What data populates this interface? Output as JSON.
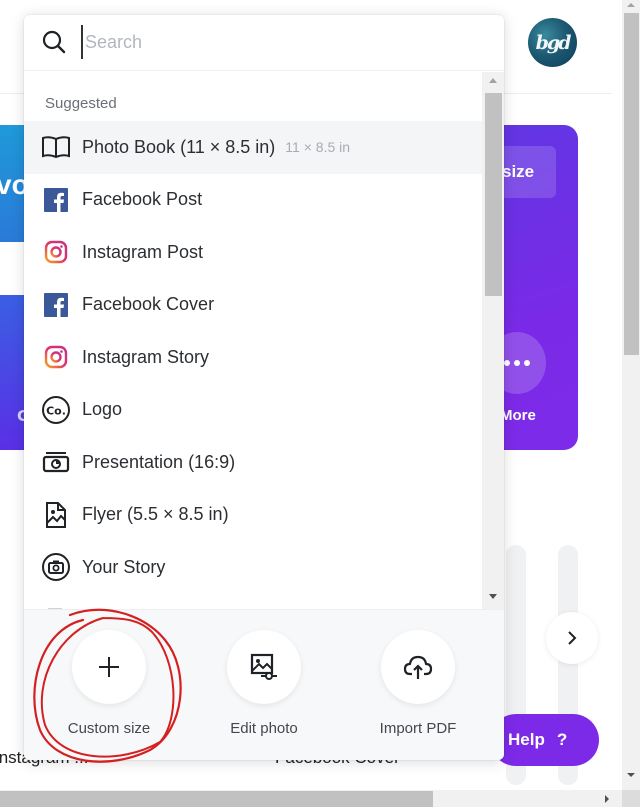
{
  "background": {
    "avatar_initials": "bgd",
    "hero_left_text": "vo",
    "hero_left_bottom_text": "G",
    "hero_right_button": "size",
    "hero_more_label": "More",
    "captions": [
      "Instagram ...",
      "Facebook Cover"
    ],
    "help_button": {
      "label": "Help",
      "icon": "?"
    }
  },
  "dropdown": {
    "search": {
      "placeholder": "Search",
      "value": ""
    },
    "section_label": "Suggested",
    "items": [
      {
        "label": "Photo Book (11 × 8.5 in)",
        "sub": "11 × 8.5 in",
        "icon": "book-icon",
        "active": true
      },
      {
        "label": "Facebook Post",
        "sub": "",
        "icon": "facebook-icon"
      },
      {
        "label": "Instagram Post",
        "sub": "",
        "icon": "instagram-icon"
      },
      {
        "label": "Facebook Cover",
        "sub": "",
        "icon": "facebook-icon"
      },
      {
        "label": "Instagram Story",
        "sub": "",
        "icon": "instagram-icon"
      },
      {
        "label": "Logo",
        "sub": "",
        "icon": "logo-icon"
      },
      {
        "label": "Presentation (16:9)",
        "sub": "",
        "icon": "presentation-icon"
      },
      {
        "label": "Flyer (5.5 × 8.5 in)",
        "sub": "",
        "icon": "flyer-icon"
      },
      {
        "label": "Your Story",
        "sub": "",
        "icon": "camera-icon"
      }
    ],
    "actions": [
      {
        "label": "Custom size",
        "icon": "plus-icon"
      },
      {
        "label": "Edit photo",
        "icon": "edit-photo-icon"
      },
      {
        "label": "Import PDF",
        "icon": "cloud-upload-icon"
      }
    ]
  },
  "colors": {
    "brand_purple": "#7d2ae8",
    "facebook_blue": "#3b5998",
    "annotation_red": "#d42020"
  }
}
